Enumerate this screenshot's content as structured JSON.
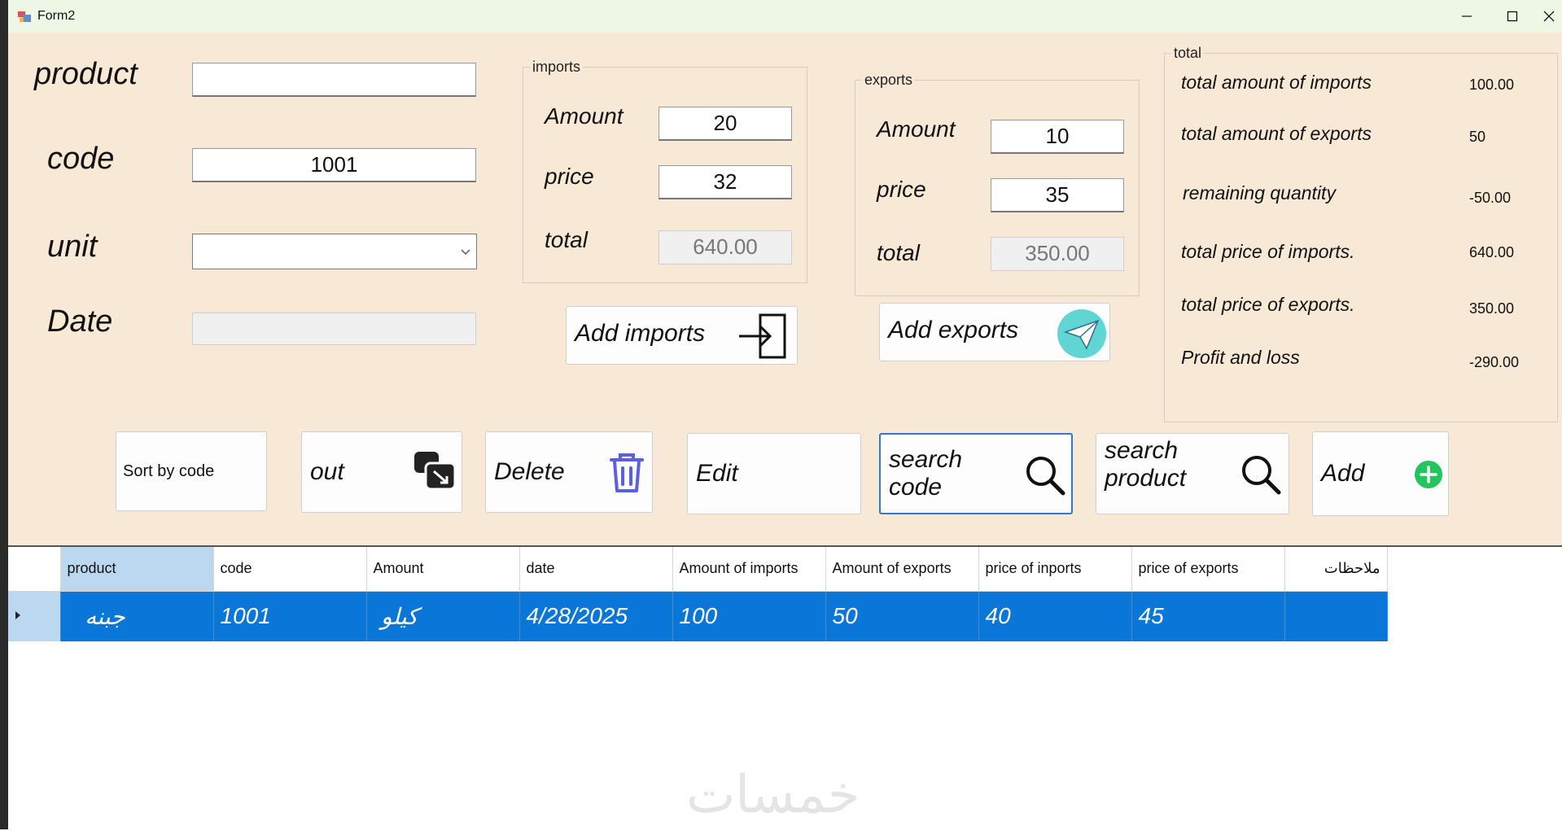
{
  "window": {
    "title": "Form2",
    "minimize_icon": "minimize-icon",
    "maximize_icon": "maximize-icon",
    "close_icon": "close-icon"
  },
  "fields": {
    "product_label": "product",
    "product_value": "",
    "code_label": "code",
    "code_value": "1001",
    "unit_label": "unit",
    "unit_value": "",
    "date_label": "Date",
    "date_value": ""
  },
  "imports": {
    "legend": "imports",
    "amount_label": "Amount",
    "amount_value": "20",
    "price_label": "price",
    "price_value": "32",
    "total_label": "total",
    "total_value": "640.00",
    "add_button": "Add imports"
  },
  "exports": {
    "legend": "exports",
    "amount_label": "Amount",
    "amount_value": "10",
    "price_label": "price",
    "price_value": "35",
    "total_label": "total",
    "total_value": "350.00",
    "add_button": "Add exports"
  },
  "totals": {
    "legend": "total",
    "rows": [
      {
        "label": "total amount of imports",
        "value": "100.00"
      },
      {
        "label": "total amount of exports",
        "value": "50"
      },
      {
        "label": "remaining quantity",
        "value": "-50.00"
      },
      {
        "label": "total price of imports.",
        "value": "640.00"
      },
      {
        "label": "total price of exports.",
        "value": "350.00"
      },
      {
        "label": "Profit and loss",
        "value": "-290.00"
      }
    ]
  },
  "actions": {
    "sort_by_code": "Sort by code",
    "out": "out",
    "delete": "Delete",
    "edit": "Edit",
    "search_code_1": "search",
    "search_code_2": "code",
    "search_product_1": "search",
    "search_product_2": "product",
    "add": "Add"
  },
  "grid": {
    "columns": [
      "product",
      "code",
      "Amount",
      "date",
      "Amount of imports",
      "Amount of exports",
      "price of inports",
      "price of exports",
      "ملاحظات"
    ],
    "rows": [
      {
        "product": "جبنه",
        "code": "1001",
        "amount": "كيلو",
        "date": "4/28/2025",
        "amount_imports": "100",
        "amount_exports": "50",
        "price_imports": "40",
        "price_exports": "45",
        "notes": ""
      }
    ]
  },
  "watermark": "خمسات",
  "colors": {
    "form_bg": "#f8e9d6",
    "titlebar_bg": "#eef6e6",
    "selection": "#0a76d8",
    "header_selected": "#bcd8f0",
    "focus_border": "#2d78d4",
    "trash_icon": "#5b5ee6",
    "plus_icon": "#22c55e",
    "plane_icon_bg": "#5fd6d4"
  }
}
